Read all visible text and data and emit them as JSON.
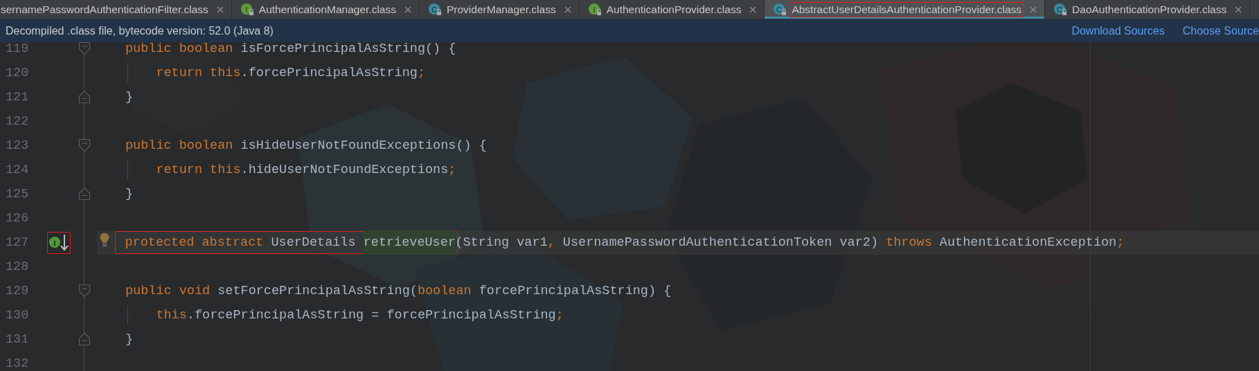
{
  "tabs": [
    {
      "label": "sernamePasswordAuthenticationFilter.class",
      "selected": false,
      "outlined": false
    },
    {
      "label": "AuthenticationManager.class",
      "icon": {
        "kind": "interface",
        "letter": "I"
      },
      "selected": false,
      "outlined": false
    },
    {
      "label": "ProviderManager.class",
      "icon": {
        "kind": "class",
        "letter": "C"
      },
      "selected": false,
      "outlined": false
    },
    {
      "label": "AuthenticationProvider.class",
      "icon": {
        "kind": "interface",
        "letter": "I"
      },
      "selected": false,
      "outlined": false
    },
    {
      "label": "AbstractUserDetailsAuthenticationProvider.class",
      "icon": {
        "kind": "class",
        "letter": "C"
      },
      "selected": true,
      "outlined": true
    },
    {
      "label": "DaoAuthenticationProvider.class",
      "icon": {
        "kind": "class",
        "letter": "C"
      },
      "selected": false,
      "outlined": false
    }
  ],
  "info_bar": {
    "message": "Decompiled .class file, bytecode version: 52.0 (Java 8)",
    "links": [
      "Download Sources",
      "Choose Source"
    ]
  },
  "lines": [
    {
      "number": "119",
      "fold": {
        "kind": "start"
      },
      "tokens": [
        {
          "kind": "keyword",
          "text": "public boolean"
        },
        {
          "kind": "plain",
          "text": " isForcePrincipalAsString() {"
        }
      ]
    },
    {
      "number": "120",
      "indent_guide": true,
      "tokens": [
        {
          "kind": "keyword",
          "text": "    return this"
        },
        {
          "kind": "plain",
          "text": ".forcePrincipalAsString"
        },
        {
          "kind": "keyword",
          "text": ";"
        }
      ]
    },
    {
      "number": "121",
      "fold": {
        "kind": "end"
      },
      "tokens": [
        {
          "kind": "plain",
          "text": "}"
        }
      ]
    },
    {
      "number": "122"
    },
    {
      "number": "123",
      "fold": {
        "kind": "start"
      },
      "tokens": [
        {
          "kind": "keyword",
          "text": "public boolean"
        },
        {
          "kind": "plain",
          "text": " isHideUserNotFoundExceptions() {"
        }
      ]
    },
    {
      "number": "124",
      "indent_guide": true,
      "tokens": [
        {
          "kind": "keyword",
          "text": "    return this"
        },
        {
          "kind": "plain",
          "text": ".hideUserNotFoundExceptions"
        },
        {
          "kind": "keyword",
          "text": ";"
        }
      ]
    },
    {
      "number": "125",
      "fold": {
        "kind": "end"
      },
      "tokens": [
        {
          "kind": "plain",
          "text": "}"
        }
      ]
    },
    {
      "number": "126"
    },
    {
      "number": "127",
      "current": true,
      "bulb": true,
      "marker": {
        "letter": "I",
        "outlined": true
      },
      "boxed_tokens": [
        {
          "kind": "keyword",
          "text": "protected abstract"
        },
        {
          "kind": "plain",
          "text": " UserDetails "
        },
        {
          "kind": "usage",
          "text": "retrieveUser"
        }
      ],
      "tokens": [
        {
          "kind": "plain",
          "text": "(String var1"
        },
        {
          "kind": "keyword",
          "text": ","
        },
        {
          "kind": "plain",
          "text": " UsernamePasswordAuthenticationToken var2) "
        },
        {
          "kind": "keyword",
          "text": "throws"
        },
        {
          "kind": "plain",
          "text": " AuthenticationException"
        },
        {
          "kind": "keyword",
          "text": ";"
        }
      ]
    },
    {
      "number": "128"
    },
    {
      "number": "129",
      "fold": {
        "kind": "start"
      },
      "tokens": [
        {
          "kind": "keyword",
          "text": "public void"
        },
        {
          "kind": "plain",
          "text": " setForcePrincipalAsString("
        },
        {
          "kind": "keyword",
          "text": "boolean"
        },
        {
          "kind": "plain",
          "text": " forcePrincipalAsString) {"
        }
      ]
    },
    {
      "number": "130",
      "indent_guide": true,
      "tokens": [
        {
          "kind": "keyword",
          "text": "    this"
        },
        {
          "kind": "plain",
          "text": ".forcePrincipalAsString = forcePrincipalAsString"
        },
        {
          "kind": "keyword",
          "text": ";"
        }
      ]
    },
    {
      "number": "131",
      "fold": {
        "kind": "end"
      },
      "tokens": [
        {
          "kind": "plain",
          "text": "}"
        }
      ]
    },
    {
      "number": "132"
    }
  ]
}
